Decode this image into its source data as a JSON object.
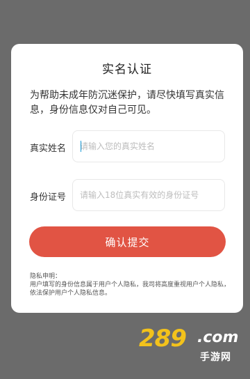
{
  "dialog": {
    "title": "实名认证",
    "intro": "为帮助未成年防沉迷保护，请尽快填写真实信息，身份信息仅对自己可见。",
    "name_label": "真实姓名",
    "name_placeholder": "请输入您的真实姓名",
    "id_label": "身份证号",
    "id_placeholder": "请输入18位真实有效的身份证号",
    "submit_label": "确认提交",
    "privacy_title": "隐私申明：",
    "privacy_text": "用户填写的身份信息属于用户个人隐私，我司将高度重视用户个人隐私，依法保护用户个人隐私信息。"
  },
  "watermark": {
    "number": "289",
    "suffix": ".com",
    "subtitle": "手游网"
  },
  "colors": {
    "submit_bg": "#e15444",
    "overlay": "#6b6b6b",
    "watermark_yellow": "#f3c21b"
  }
}
